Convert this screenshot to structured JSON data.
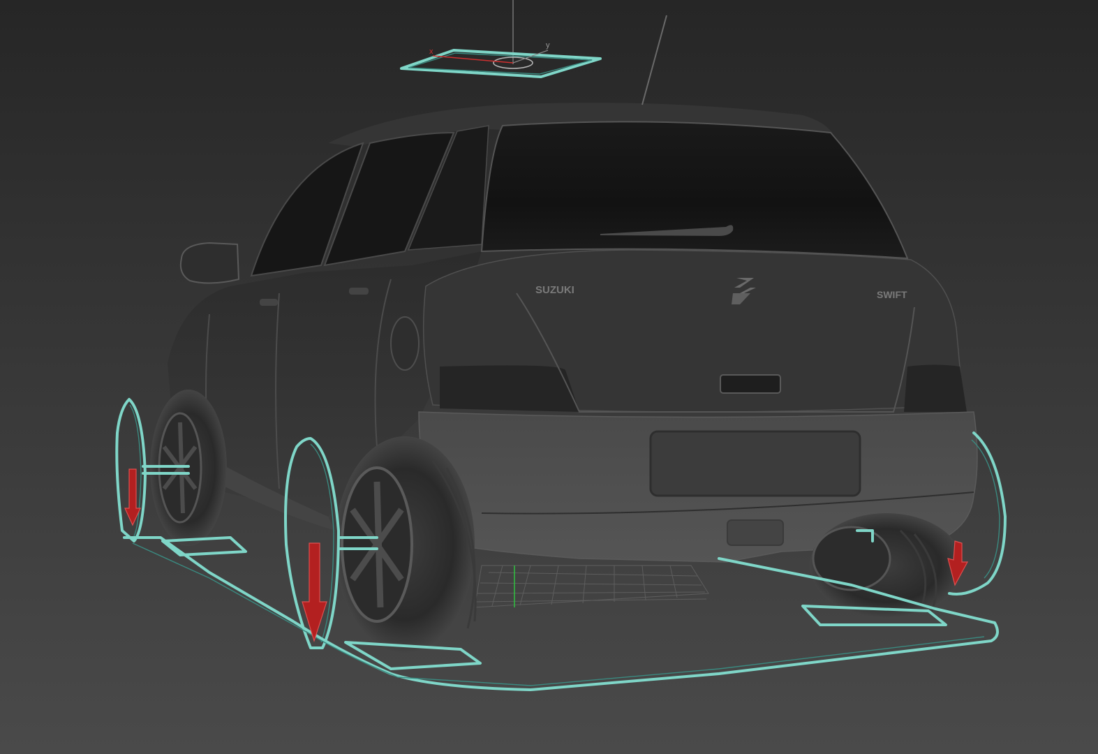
{
  "viewport": {
    "background_top": "#262626",
    "background_bottom": "#4a4a4a",
    "rig_color": "#7fd6c8",
    "arrow_color": "#b32020",
    "axis_x_color": "#d03030",
    "axis_y_color": "#30c040"
  },
  "car": {
    "badge_left": "SUZUKI",
    "badge_right": "SWIFT",
    "body_color": "#3a3a3a"
  },
  "gizmo": {
    "axis_x_label": "x",
    "axis_y_label": "y"
  },
  "icons": [
    "suzuki-logo-icon",
    "down-arrow-icon",
    "axis-gizmo-icon"
  ]
}
